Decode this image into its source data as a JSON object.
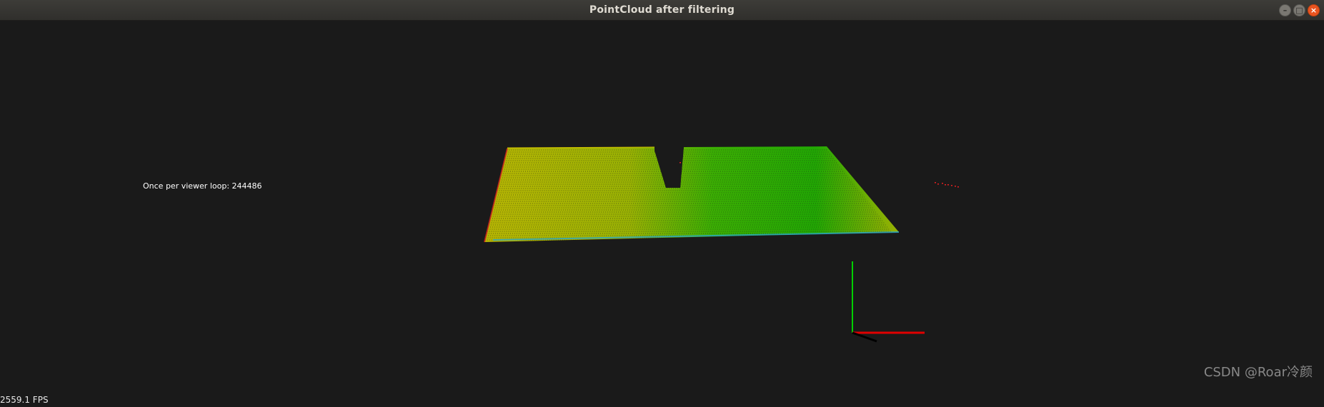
{
  "window": {
    "title": "PointCloud after filtering",
    "controls": {
      "minimize": "–",
      "maximize": "□",
      "close": "×"
    }
  },
  "viewer": {
    "loop_text": "Once per viewer loop: 244486",
    "fps_text": "2559.1 FPS",
    "background": "#1a1a1a",
    "axes": {
      "x_color": "#e00000",
      "y_color": "#00d000",
      "z_color": "#000000"
    }
  },
  "watermark": "CSDN @Roar冷颜"
}
